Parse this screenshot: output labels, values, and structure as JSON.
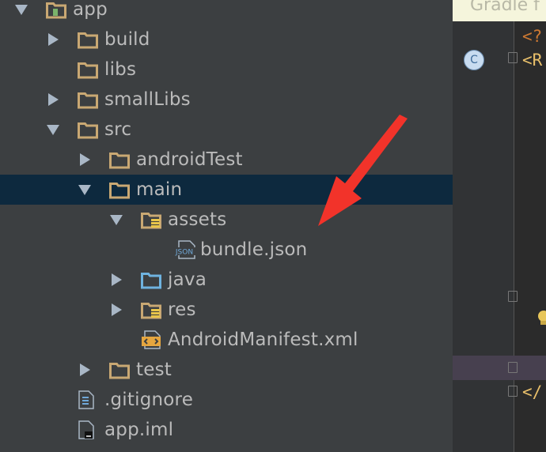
{
  "project_tree": {
    "items": [
      {
        "label": "app",
        "indent": 0,
        "expanded": true,
        "icon": "module-folder-icon"
      },
      {
        "label": "build",
        "indent": 1,
        "expanded": false,
        "icon": "folder-icon"
      },
      {
        "label": "libs",
        "indent": 1,
        "expanded": null,
        "icon": "folder-icon"
      },
      {
        "label": "smallLibs",
        "indent": 1,
        "expanded": false,
        "icon": "folder-icon"
      },
      {
        "label": "src",
        "indent": 1,
        "expanded": true,
        "icon": "folder-icon"
      },
      {
        "label": "androidTest",
        "indent": 2,
        "expanded": false,
        "icon": "folder-icon"
      },
      {
        "label": "main",
        "indent": 2,
        "expanded": true,
        "icon": "folder-icon",
        "selected": true
      },
      {
        "label": "assets",
        "indent": 3,
        "expanded": true,
        "icon": "resource-folder-icon"
      },
      {
        "label": "bundle.json",
        "indent": 4,
        "expanded": null,
        "icon": "json-file-icon"
      },
      {
        "label": "java",
        "indent": 3,
        "expanded": false,
        "icon": "source-folder-icon"
      },
      {
        "label": "res",
        "indent": 3,
        "expanded": false,
        "icon": "resource-folder-icon"
      },
      {
        "label": "AndroidManifest.xml",
        "indent": 3,
        "expanded": null,
        "icon": "xml-file-icon"
      },
      {
        "label": "test",
        "indent": 2,
        "expanded": false,
        "icon": "folder-icon"
      },
      {
        "label": ".gitignore",
        "indent": 1,
        "expanded": null,
        "icon": "text-file-icon"
      },
      {
        "label": "app.iml",
        "indent": 1,
        "expanded": null,
        "icon": "iml-file-icon"
      }
    ]
  },
  "editor": {
    "tab_label": "Gradle f",
    "lines": [
      {
        "text": "<?",
        "color": "#cc7832"
      },
      {
        "text": "<R",
        "color": "#e8bf6a"
      },
      {
        "text": "</",
        "color": "#e8bf6a"
      }
    ],
    "class_badge": "C"
  },
  "colors": {
    "tree_background": "#3c3f41",
    "selection": "#0d293e",
    "editor_background": "#2b2b2b",
    "annotation_arrow": "#f2332a"
  }
}
